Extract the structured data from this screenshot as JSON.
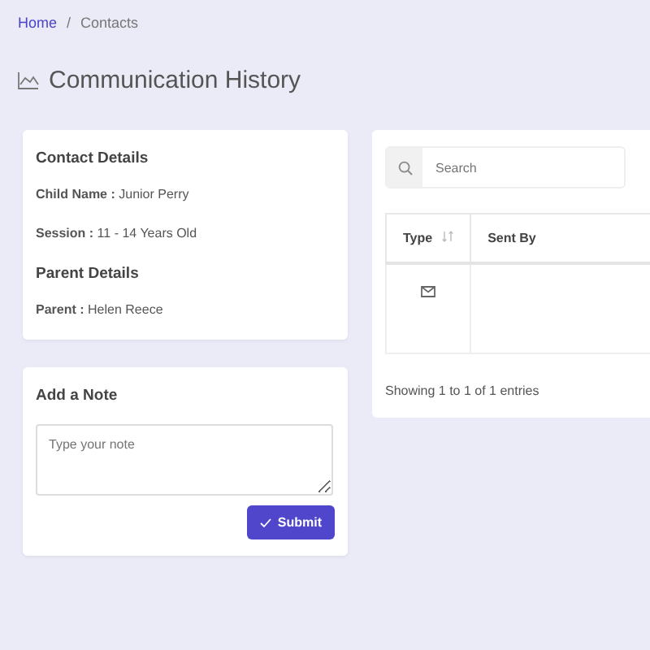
{
  "breadcrumb_separator": "/",
  "breadcrumb": [
    {
      "label": "Home",
      "link": true
    },
    {
      "label": "Contacts",
      "link": false
    }
  ],
  "title": "Communication History",
  "contact_card": {
    "heading": "Contact Details",
    "fields": [
      "**Child Name :** Junior Perry",
      "**Session :** 11 - 14 Years Old"
    ],
    "parent_heading": "Parent Details",
    "parent_fields": [
      "**Parent :** Helen Reece"
    ]
  },
  "note_card": {
    "heading": "Add a Note",
    "placeholder": "Type your note",
    "button": "Submit"
  },
  "history": {
    "search": {
      "placeholder": "Search"
    },
    "columns": [
      {
        "label": "Type",
        "sortable": true
      },
      {
        "label": "Sent By",
        "sortable": false
      }
    ],
    "rows": [
      {
        "kind": "email"
      }
    ],
    "footer": "Showing 1 to 1 of 1 entries"
  }
}
